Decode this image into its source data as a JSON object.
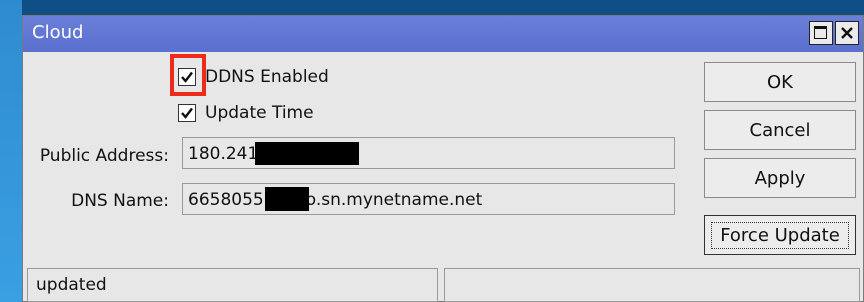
{
  "window": {
    "title": "Cloud"
  },
  "checkboxes": [
    {
      "label": "DDNS Enabled",
      "checked": true
    },
    {
      "label": "Update Time",
      "checked": true
    }
  ],
  "fields": {
    "public_address": {
      "label": "Public Address:",
      "value": "180.241"
    },
    "dns_name": {
      "label": "DNS Name:",
      "value_prefix": "6658055",
      "value_suffix": "o.sn.mynetname.net"
    }
  },
  "buttons": {
    "ok": "OK",
    "cancel": "Cancel",
    "apply": "Apply",
    "force_update": "Force Update"
  },
  "status": {
    "left": "updated",
    "right": ""
  },
  "colors": {
    "titlebar": "#5f73d2",
    "highlight": "#ee2a1b",
    "window_bg": "#e7e7e7"
  }
}
